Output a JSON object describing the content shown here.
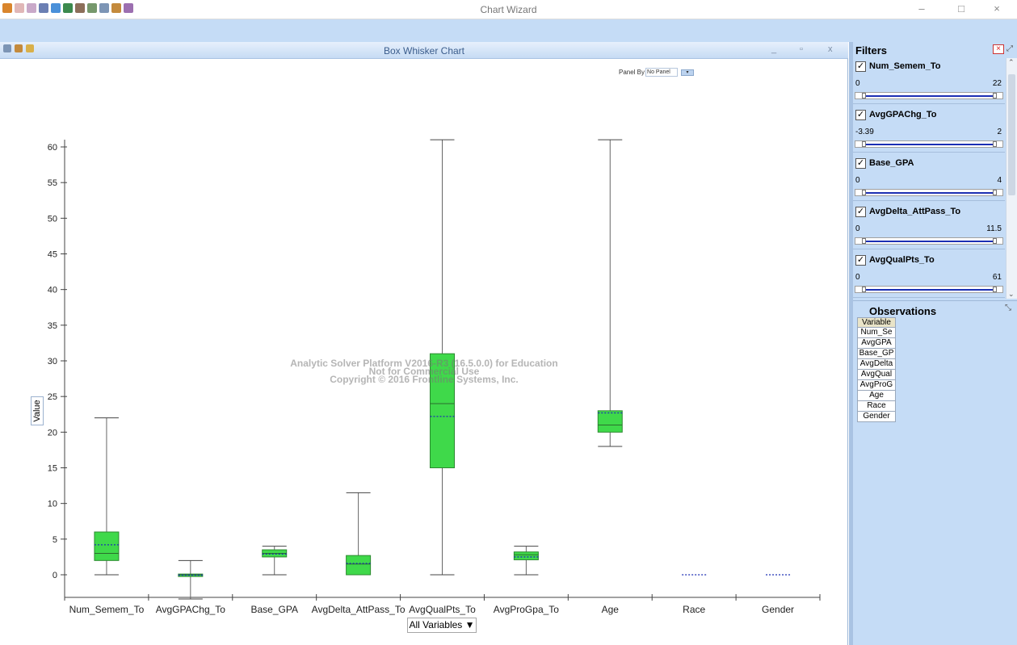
{
  "app": {
    "title": "Chart Wizard",
    "minimize": "–",
    "maximize": "□",
    "close": "×"
  },
  "chart_window": {
    "title": "Box Whisker Chart",
    "minimize": "_",
    "maximize": "▫",
    "close": "x",
    "panel_by_label": "Panel By",
    "panel_by_value": "No Panel"
  },
  "chart_data": {
    "type": "boxplot",
    "title": "Box Whisker Chart",
    "xlabel": "All Variables ▼",
    "ylabel": "Value",
    "ylim": [
      -3.5,
      62
    ],
    "yticks": [
      0,
      5,
      10,
      15,
      20,
      25,
      30,
      35,
      40,
      45,
      50,
      55,
      60
    ],
    "categories": [
      "Num_Semem_To",
      "AvgGPAChg_To",
      "Base_GPA",
      "AvgDelta_AttPass_To",
      "AvgQualPts_To",
      "AvgProGpa_To",
      "Age",
      "Race",
      "Gender"
    ],
    "boxes": [
      {
        "min": 0,
        "q1": 2,
        "median": 3,
        "mean": 4.2,
        "q3": 6,
        "max": 22
      },
      {
        "min": -3.39,
        "q1": -0.1,
        "median": 0,
        "mean": -0.05,
        "q3": 0.1,
        "max": 2
      },
      {
        "min": 0,
        "q1": 2.5,
        "median": 3,
        "mean": 2.9,
        "q3": 3.5,
        "max": 4
      },
      {
        "min": 0,
        "q1": 0,
        "median": 1.5,
        "mean": 1.6,
        "q3": 2.7,
        "max": 11.5
      },
      {
        "min": 0,
        "q1": 15,
        "median": 24,
        "mean": 22.2,
        "q3": 31,
        "max": 61
      },
      {
        "min": 0,
        "q1": 2.1,
        "median": 2.8,
        "mean": 2.5,
        "q3": 3.2,
        "max": 4
      },
      {
        "min": 18,
        "q1": 20,
        "median": 21,
        "mean": 22.7,
        "q3": 23,
        "max": 61
      },
      {
        "min": 0,
        "q1": 0,
        "median": 0,
        "mean": 0,
        "q3": 0,
        "max": 0
      },
      {
        "min": 0,
        "q1": 0,
        "median": 0,
        "mean": 0,
        "q3": 0,
        "max": 0
      }
    ],
    "box_color": "#3fd94a",
    "mean_color": "#1c2fb3"
  },
  "watermark": {
    "line1": "Analytic Solver Platform V2016-R3 (16.5.0.0) for Education",
    "line2": "Not for Commercial Use",
    "line3": "Copyright © 2016 Frontline Systems, Inc."
  },
  "filters": {
    "title": "Filters",
    "items": [
      {
        "name": "Num_Semem_To",
        "min": "0",
        "max": "22"
      },
      {
        "name": "AvgGPAChg_To",
        "min": "-3.39",
        "max": "2"
      },
      {
        "name": "Base_GPA",
        "min": "0",
        "max": "4"
      },
      {
        "name": "AvgDelta_AttPass_To",
        "min": "0",
        "max": "11.5"
      },
      {
        "name": "AvgQualPts_To",
        "min": "0",
        "max": "61"
      }
    ]
  },
  "observations": {
    "title": "Observations",
    "header": "Variable",
    "rows": [
      "Num_Se",
      "AvgGPA",
      "Base_GP",
      "AvgDelta",
      "AvgQual",
      "AvgProG",
      "Age",
      "Race",
      "Gender"
    ]
  }
}
